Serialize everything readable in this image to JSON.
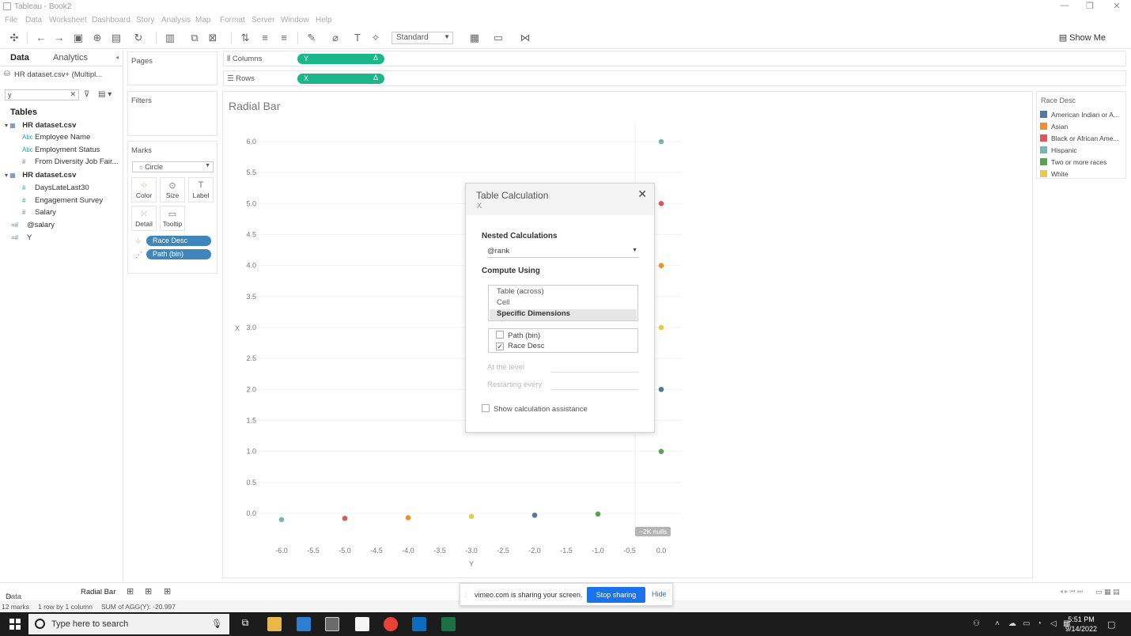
{
  "window": {
    "title": "Tableau - Book2"
  },
  "menu": [
    "File",
    "Data",
    "Worksheet",
    "Dashboard",
    "Story",
    "Analysis",
    "Map",
    "Format",
    "Server",
    "Window",
    "Help"
  ],
  "toolbar": {
    "fit": "Standard",
    "show_me": "Show Me"
  },
  "left_panel": {
    "tab_data": "Data",
    "tab_analytics": "Analytics",
    "datasource": "HR dataset.csv+ (Multipl...",
    "search_value": "y",
    "tables_header": "Tables",
    "fields": [
      {
        "name": "HR dataset.csv",
        "kind": "table"
      },
      {
        "name": "Employee Name",
        "kind": "dim",
        "icon": "Abc"
      },
      {
        "name": "Employment Status",
        "kind": "dim",
        "icon": "Abc"
      },
      {
        "name": "From Diversity Job Fair...",
        "kind": "measure",
        "icon": "#"
      },
      {
        "name": "HR dataset.csv",
        "kind": "table"
      },
      {
        "name": "DaysLateLast30",
        "kind": "measure",
        "icon": "#"
      },
      {
        "name": "Engagement Survey",
        "kind": "measure",
        "icon": "#"
      },
      {
        "name": "Salary",
        "kind": "measure",
        "icon": "#"
      },
      {
        "name": "@salary",
        "kind": "calc",
        "icon": "=#"
      },
      {
        "name": "Y",
        "kind": "calc",
        "icon": "=#"
      }
    ]
  },
  "cards": {
    "pages": "Pages",
    "filters": "Filters",
    "marks": "Marks",
    "mark_type": "Circle",
    "mark_buttons": [
      "Color",
      "Size",
      "Label",
      "Detail",
      "Tooltip"
    ],
    "mark_pills": [
      "Race Desc",
      "Path (bin)"
    ]
  },
  "shelves": {
    "columns_label": "Columns",
    "rows_label": "Rows",
    "columns_pill": "Y",
    "rows_pill": "X",
    "delta": "Δ"
  },
  "viz": {
    "title": "Radial Bar",
    "nulls_badge": "~2K nulls"
  },
  "chart_data": {
    "type": "scatter",
    "title": "Radial Bar",
    "xlabel": "Y",
    "ylabel": "X",
    "xlim": [
      -6.0,
      0.0
    ],
    "ylim": [
      0.0,
      6.0
    ],
    "x_ticks": [
      "-6.0",
      "-5.5",
      "-5.0",
      "-4.5",
      "-4.0",
      "-3.5",
      "-3.0",
      "-2.5",
      "-2.0",
      "-1.5",
      "-1.0",
      "-0.5",
      "0.0"
    ],
    "y_ticks": [
      "0.0",
      "0.5",
      "1.0",
      "1.5",
      "2.0",
      "2.5",
      "3.0",
      "3.5",
      "4.0",
      "4.5",
      "5.0",
      "5.5",
      "6.0"
    ],
    "points": [
      {
        "x": 0.0,
        "y": 6.0,
        "series": "Hispanic"
      },
      {
        "x": 0.0,
        "y": 5.0,
        "series": "Black or African Ame..."
      },
      {
        "x": 0.0,
        "y": 4.0,
        "series": "Asian"
      },
      {
        "x": 0.0,
        "y": 3.0,
        "series": "White"
      },
      {
        "x": 0.0,
        "y": 2.0,
        "series": "American Indian or A..."
      },
      {
        "x": 0.0,
        "y": 1.0,
        "series": "Two or more races"
      },
      {
        "x": -6.0,
        "y": -0.1,
        "series": "Hispanic"
      },
      {
        "x": -5.0,
        "y": -0.08,
        "series": "Black or African Ame..."
      },
      {
        "x": -4.0,
        "y": -0.07,
        "series": "Asian"
      },
      {
        "x": -3.0,
        "y": -0.05,
        "series": "White"
      },
      {
        "x": -2.0,
        "y": -0.03,
        "series": "American Indian or A..."
      },
      {
        "x": -1.0,
        "y": -0.01,
        "series": "Two or more races"
      }
    ]
  },
  "legend": {
    "title": "Race Desc",
    "items": [
      {
        "label": "American Indian or A...",
        "color": "#4e79a7"
      },
      {
        "label": "Asian",
        "color": "#f28e2b"
      },
      {
        "label": "Black or African Ame...",
        "color": "#e15759"
      },
      {
        "label": "Hispanic",
        "color": "#76b7b2"
      },
      {
        "label": "Two or more races",
        "color": "#59a14f"
      },
      {
        "label": "White",
        "color": "#edc948"
      }
    ]
  },
  "dialog": {
    "title": "Table Calculation",
    "subtitle": "X",
    "nested_label": "Nested Calculations",
    "nested_value": "@rank",
    "compute_label": "Compute Using",
    "compute_options": [
      "Table (across)",
      "Cell",
      "Specific Dimensions"
    ],
    "dimensions": [
      {
        "label": "Path (bin)",
        "checked": false
      },
      {
        "label": "Race Desc",
        "checked": true
      }
    ],
    "at_level": "At the level",
    "restarting": "Restarting every",
    "assist": "Show calculation assistance"
  },
  "sheet_tabs": {
    "data_source": "Data Source",
    "active_sheet": "Radial Bar"
  },
  "status": {
    "marks": "12 marks",
    "rows_cols": "1 row by 1 column",
    "sum": "SUM of AGG(Y): -20.997"
  },
  "vimeo": {
    "message": "vimeo.com is sharing your screen.",
    "stop": "Stop sharing",
    "hide": "Hide"
  },
  "taskbar": {
    "search_placeholder": "Type here to search",
    "time": "5:51 PM",
    "date": "9/14/2022"
  }
}
